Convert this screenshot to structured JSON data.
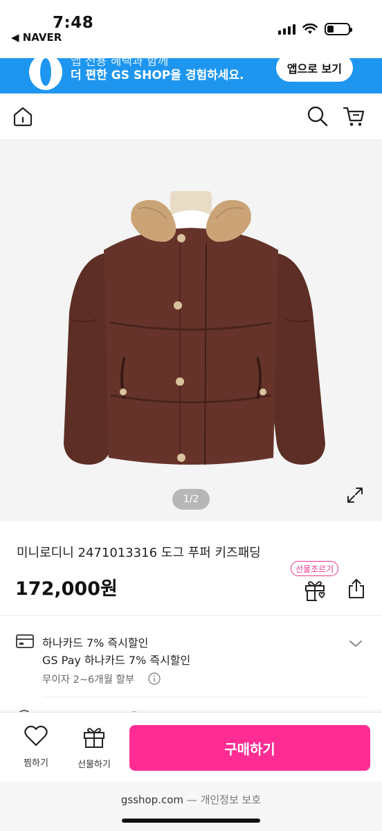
{
  "status": {
    "time": "7:48",
    "back_app": "◀ NAVER"
  },
  "banner": {
    "top_text": "앱 전용 혜택과 함께",
    "text": "더 편한 GS SHOP을 경험하세요.",
    "button": "앱으로 보기",
    "color": "#1e96f0"
  },
  "header": {
    "home_icon": "home-icon",
    "search_icon": "search-icon",
    "cart_icon": "cart-icon"
  },
  "image": {
    "counter": "1/2",
    "expand_icon": "expand-icon"
  },
  "product": {
    "title": "미니로디니 2471013316 도그 푸퍼 키즈패딩",
    "price": "172,000원",
    "gift_badge": "선물조르기"
  },
  "benefits": {
    "line1": "하나카드 7% 즉시할인",
    "line2": "GS Pay 하나카드 7% 즉시할인",
    "line3": "무이자 2~6개월 할부"
  },
  "bottom_bar": {
    "wish_label": "찜하기",
    "gift_label": "선물하기",
    "buy_label": "구매하기",
    "buy_color": "#ff2d93"
  },
  "url_bar": {
    "domain": "gsshop.com",
    "sub": "— 개인정보 보호"
  }
}
